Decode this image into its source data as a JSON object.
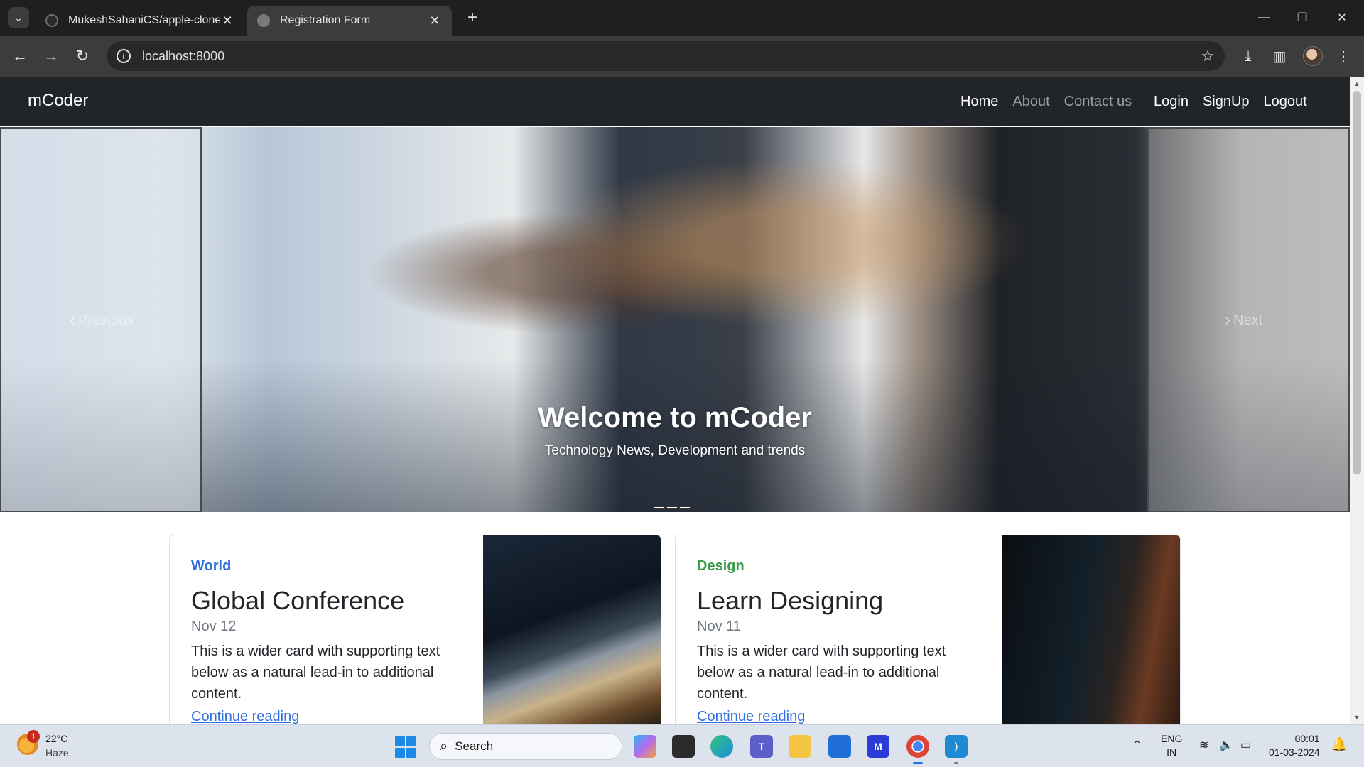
{
  "browser": {
    "tabs": [
      {
        "title": "MukeshSahaniCS/apple-clone",
        "active": false
      },
      {
        "title": "Registration Form",
        "active": true
      }
    ],
    "url": "localhost:8000",
    "tab_close_glyph": "✕",
    "new_tab_glyph": "+",
    "window_controls": {
      "minimize": "—",
      "restore": "❐",
      "close": "✕"
    }
  },
  "site": {
    "brand": "mCoder",
    "nav": [
      {
        "label": "Home",
        "active": true
      },
      {
        "label": "About",
        "active": false
      },
      {
        "label": "Contact us",
        "active": false
      }
    ],
    "auth": [
      "Login",
      "SignUp",
      "Logout"
    ]
  },
  "carousel": {
    "prev_label": "Previous",
    "next_label": "Next",
    "caption_title": "Welcome to mCoder",
    "caption_text": "Technology News, Development and trends",
    "slide_count": 3
  },
  "cards": [
    {
      "category": "World",
      "category_color": "#2f6fde",
      "title": "Global Conference",
      "date": "Nov 12",
      "text": "This is a wider card with supporting text below as a natural lead-in to additional content.",
      "link": "Continue reading"
    },
    {
      "category": "Design",
      "category_color": "#3b9b48",
      "title": "Learn Designing",
      "date": "Nov 11",
      "text": "This is a wider card with supporting text below as a natural lead-in to additional content.",
      "link": "Continue reading"
    }
  ],
  "taskbar": {
    "weather": {
      "temp": "22°C",
      "condition": "Haze",
      "badge": "1"
    },
    "search_label": "Search",
    "language": {
      "line1": "ENG",
      "line2": "IN"
    },
    "time": "00:01",
    "date": "01-03-2024"
  },
  "colors": {
    "chrome_bg": "#1f1f1f",
    "toolbar_bg": "#3c3c3c",
    "site_nav_bg": "#212529",
    "link_blue": "#2f6fde",
    "taskbar_bg": "#dde3ec"
  }
}
